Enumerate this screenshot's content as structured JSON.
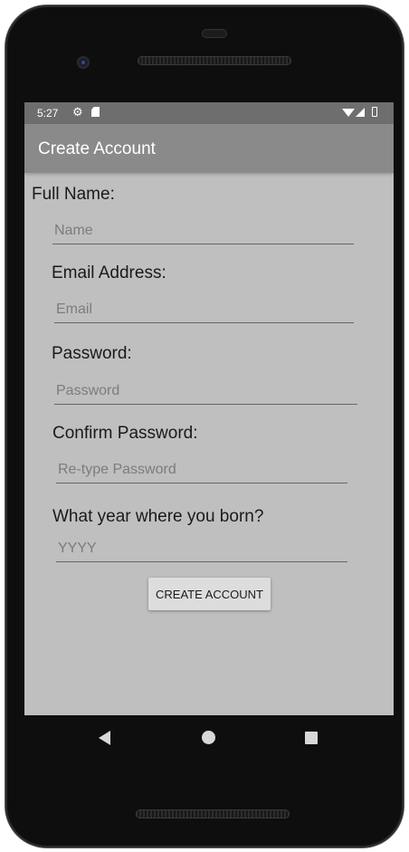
{
  "status_bar": {
    "time": "5:27",
    "icons": [
      "gear-icon",
      "sd-card-icon",
      "wifi-icon",
      "signal-icon",
      "battery-icon"
    ]
  },
  "app_bar": {
    "title": "Create Account"
  },
  "form": {
    "full_name": {
      "label": "Full Name:",
      "placeholder": "Name",
      "value": ""
    },
    "email": {
      "label": "Email Address:",
      "placeholder": "Email",
      "value": ""
    },
    "password": {
      "label": "Password:",
      "placeholder": "Password",
      "value": ""
    },
    "confirm_password": {
      "label": "Confirm Password:",
      "placeholder": "Re-type Password",
      "value": ""
    },
    "birth_year": {
      "label": "What year where you born?",
      "placeholder": "YYYY",
      "value": ""
    },
    "submit_label": "CREATE ACCOUNT"
  },
  "nav_bar": {
    "icons": [
      "back-icon",
      "home-icon",
      "recents-icon"
    ]
  },
  "colors": {
    "screen_background": "#bfbfbf",
    "app_bar": "#8a8a8a",
    "status_bar": "#6e6e6e",
    "button": "#dddddd"
  }
}
